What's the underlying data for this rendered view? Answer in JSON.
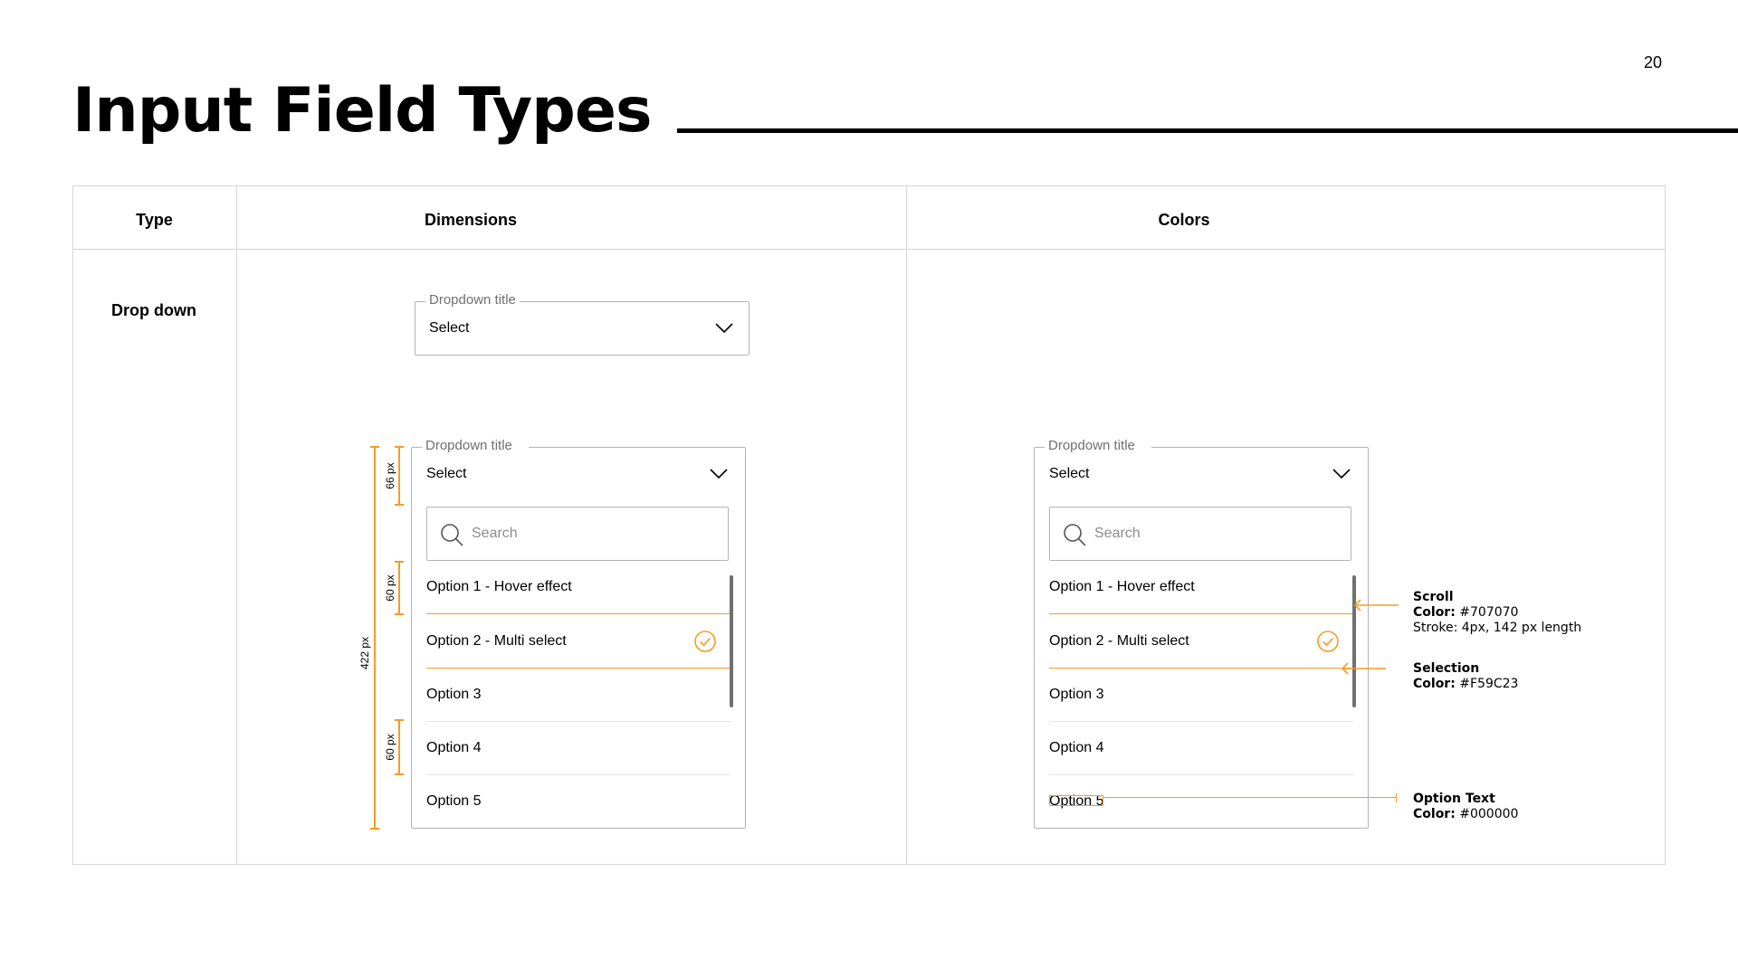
{
  "page": {
    "title": "Input Field Types",
    "number": "20"
  },
  "table": {
    "headers": {
      "type": "Type",
      "dimensions": "Dimensions",
      "colors": "Colors"
    },
    "rows": [
      {
        "type": "Drop down"
      }
    ]
  },
  "dropdown": {
    "title": "Dropdown title",
    "value": "Select",
    "search_placeholder": "Search",
    "options": [
      "Option 1 - Hover effect",
      "Option 2 - Multi select",
      "Option 3",
      "Option 4",
      "Option 5"
    ]
  },
  "dimensions": {
    "total": "422 px",
    "header": "66 px",
    "search": "60 px",
    "option": "60 px"
  },
  "annotations": {
    "scroll": {
      "title": "Scroll",
      "color_label": "Color:",
      "color": "#707070",
      "stroke": "Stroke: 4px, 142 px length"
    },
    "selection": {
      "title": "Selection",
      "color_label": "Color:",
      "color": "#F59C23"
    },
    "option_text": {
      "title": "Option Text",
      "color_label": "Color:",
      "color": "#000000"
    }
  },
  "icons": {
    "chevron": "chevron-down-icon",
    "search": "search-icon",
    "check": "check-circle-icon",
    "arrow": "arrow-left-icon"
  },
  "colors": {
    "accent": "#F59C23",
    "scroll": "#707070",
    "text": "#000000",
    "border": "#b4b4b4",
    "grid": "#d6d6d6"
  }
}
